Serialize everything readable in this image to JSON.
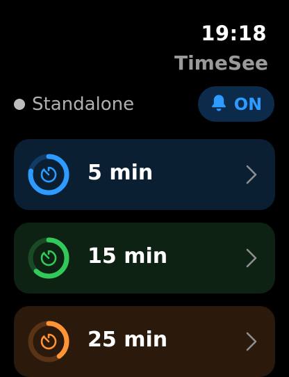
{
  "status": {
    "time": "19:18"
  },
  "app": {
    "title": "TimeSee"
  },
  "mode": {
    "label": "Standalone"
  },
  "alerts_toggle": {
    "label": "ON",
    "icon": "bell-icon"
  },
  "timers": [
    {
      "label": "5 min",
      "accent": "#2d9bff",
      "track": "#123a66",
      "progress": 0.78,
      "icon": "timer-icon"
    },
    {
      "label": "15 min",
      "accent": "#32c85a",
      "track": "#184a25",
      "progress": 0.62,
      "icon": "timer-icon"
    },
    {
      "label": "25 min",
      "accent": "#ff9436",
      "track": "#5a3215",
      "progress": 0.4,
      "icon": "timer-icon"
    }
  ]
}
